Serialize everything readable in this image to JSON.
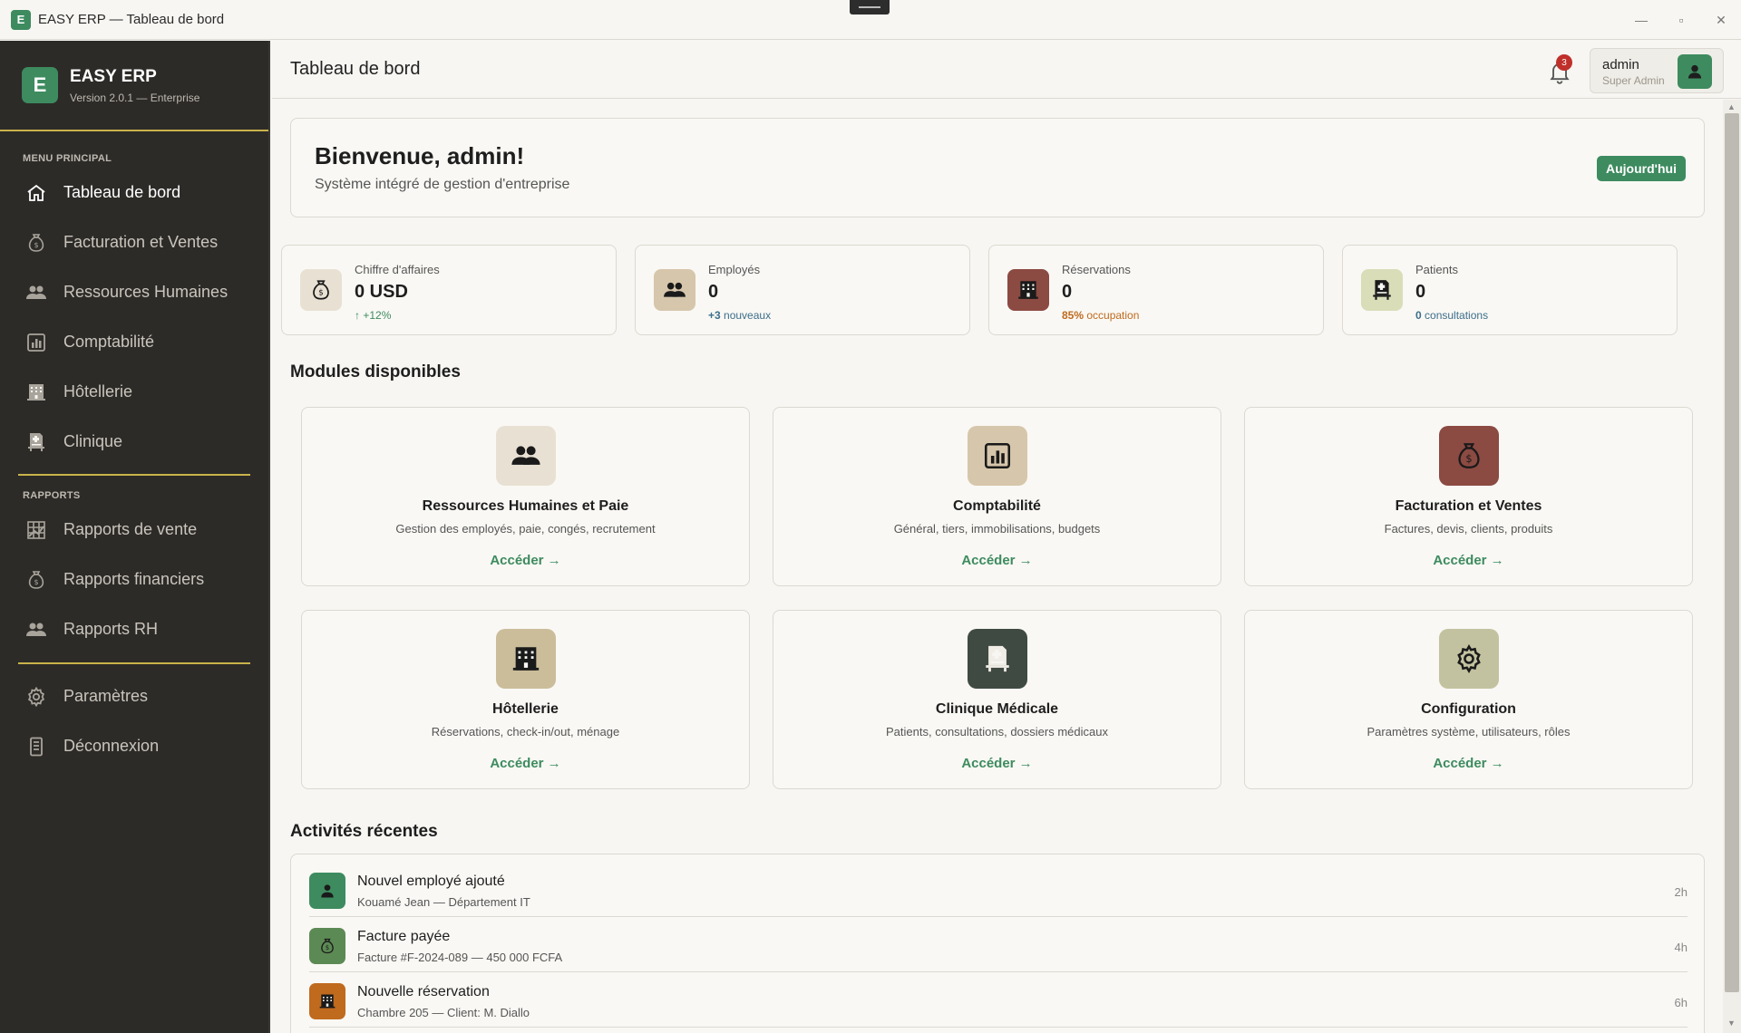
{
  "window": {
    "logo_letter": "E",
    "title": "EASY ERP — Tableau de bord",
    "minimize": "—",
    "maximize": "▫",
    "close": "✕"
  },
  "sidebar": {
    "brand_letter": "E",
    "brand_name": "EASY ERP",
    "version": "Version 2.0.1 — Enterprise",
    "main_section_label": "MENU PRINCIPAL",
    "main_items": [
      {
        "label": "Tableau de bord",
        "icon": "home-icon",
        "active": true
      },
      {
        "label": "Facturation et Ventes",
        "icon": "money-bag-icon"
      },
      {
        "label": "Ressources Humaines",
        "icon": "people-icon"
      },
      {
        "label": "Comptabilité",
        "icon": "chart-icon"
      },
      {
        "label": "Hôtellerie",
        "icon": "hotel-icon"
      },
      {
        "label": "Clinique",
        "icon": "clinic-icon"
      }
    ],
    "reports_section_label": "RAPPORTS",
    "report_items": [
      {
        "label": "Rapports de vente",
        "icon": "sales-chart-icon"
      },
      {
        "label": "Rapports financiers",
        "icon": "money-bag-icon"
      },
      {
        "label": "Rapports RH",
        "icon": "people-icon"
      }
    ],
    "bottom_items": [
      {
        "label": "Paramètres",
        "icon": "gear-icon"
      },
      {
        "label": "Déconnexion",
        "icon": "logout-icon"
      }
    ]
  },
  "header": {
    "title": "Tableau de bord",
    "notification_count": "3",
    "user_name": "admin",
    "user_role": "Super Admin"
  },
  "welcome": {
    "title": "Bienvenue, admin!",
    "subtitle": "Système intégré de gestion d'entreprise",
    "today_button": "Aujourd'hui"
  },
  "stats": [
    {
      "label": "Chiffre d'affaires",
      "value": "0 USD",
      "extra_strong": "↑ +12%",
      "extra_text": "",
      "icon": "money-bag-icon",
      "icon_bg": "#e8e1d3",
      "extra_color": "#3d8b5f"
    },
    {
      "label": "Employés",
      "value": "0",
      "extra_strong": "+3",
      "extra_text": " nouveaux",
      "icon": "people-icon",
      "icon_bg": "#d6c6ab",
      "extra_color": "#3d6f8b"
    },
    {
      "label": "Réservations",
      "value": "0",
      "extra_strong": "85%",
      "extra_text": " occupation",
      "icon": "hotel-icon",
      "icon_bg": "#8b4a42",
      "extra_color": "#c06a1e"
    },
    {
      "label": "Patients",
      "value": "0",
      "extra_strong": "0",
      "extra_text": " consultations",
      "icon": "clinic-icon",
      "icon_bg": "#d9ddb8",
      "extra_color": "#3d6f8b"
    }
  ],
  "modules_title": "Modules disponibles",
  "modules": [
    {
      "title": "Ressources Humaines et Paie",
      "desc": "Gestion des employés, paie, congés, recrutement",
      "link": "Accéder →",
      "icon": "people-icon",
      "icon_bg": "#e8e1d3"
    },
    {
      "title": "Comptabilité",
      "desc": "Général, tiers, immobilisations, budgets",
      "link": "Accéder →",
      "icon": "chart-icon",
      "icon_bg": "#d6c6ab"
    },
    {
      "title": "Facturation et Ventes",
      "desc": "Factures, devis, clients, produits",
      "link": "Accéder →",
      "icon": "money-bag-icon",
      "icon_bg": "#8b4a42"
    },
    {
      "title": "Hôtellerie",
      "desc": "Réservations, check-in/out, ménage",
      "link": "Accéder →",
      "icon": "hotel-icon",
      "icon_bg": "#cbbd9a"
    },
    {
      "title": "Clinique Médicale",
      "desc": "Patients, consultations, dossiers médicaux",
      "link": "Accéder →",
      "icon": "clinic-icon",
      "icon_bg": "#3f4a42"
    },
    {
      "title": "Configuration",
      "desc": "Paramètres système, utilisateurs, rôles",
      "link": "Accéder →",
      "icon": "gear-icon",
      "icon_bg": "#c3c2a0"
    }
  ],
  "activity_title": "Activités récentes",
  "activities": [
    {
      "title": "Nouvel employé ajouté",
      "sub": "Kouamé Jean — Département IT",
      "time": "2h",
      "icon": "person-icon",
      "icon_bg": "#3d8b5f"
    },
    {
      "title": "Facture payée",
      "sub": "Facture #F-2024-089 — 450 000 FCFA",
      "time": "4h",
      "icon": "money-bag-icon",
      "icon_bg": "#5c8a54"
    },
    {
      "title": "Nouvelle réservation",
      "sub": "Chambre 205 — Client: M. Diallo",
      "time": "6h",
      "icon": "hotel-icon",
      "icon_bg": "#c06a1e"
    }
  ],
  "colors": {
    "accent": "#3d8b5f",
    "sidebar_bg": "#2d2b28",
    "divider_gold": "#c8b34a",
    "badge_red": "#c0302b"
  }
}
